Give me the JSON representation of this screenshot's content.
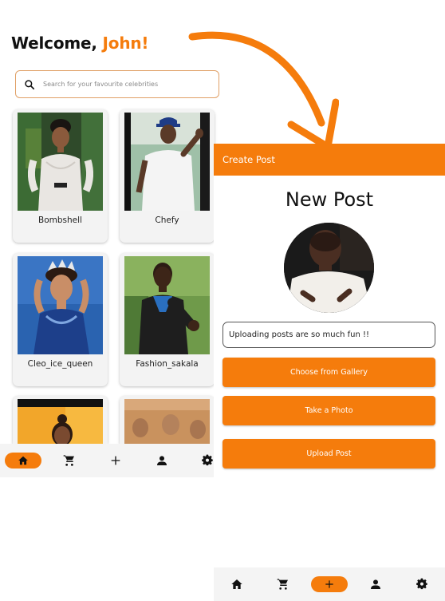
{
  "home": {
    "welcome_prefix": "Welcome,",
    "welcome_name": "John!",
    "search_placeholder": "Search for your favourite celebrities",
    "cards": [
      {
        "label": "Bombshell"
      },
      {
        "label": "Chefy"
      },
      {
        "label": "Cleo_ice_queen"
      },
      {
        "label": "Fashion_sakala"
      },
      {
        "label": ""
      },
      {
        "label": ""
      }
    ]
  },
  "create_post": {
    "appbar_title": "Create Post",
    "heading": "New Post",
    "caption_value": "Uploading posts are so much fun !!",
    "buttons": {
      "gallery": "Choose from Gallery",
      "photo": "Take a Photo",
      "upload": "Upload Post"
    }
  },
  "nav": {
    "items": [
      "home-icon",
      "cart-icon",
      "plus-icon",
      "person-icon",
      "settings-icon"
    ],
    "left_active": "home-icon",
    "right_active": "plus-icon"
  },
  "colors": {
    "accent": "#f57c0c",
    "nav_bg": "#f4f4f4",
    "card_bg": "#f3f3f3"
  }
}
